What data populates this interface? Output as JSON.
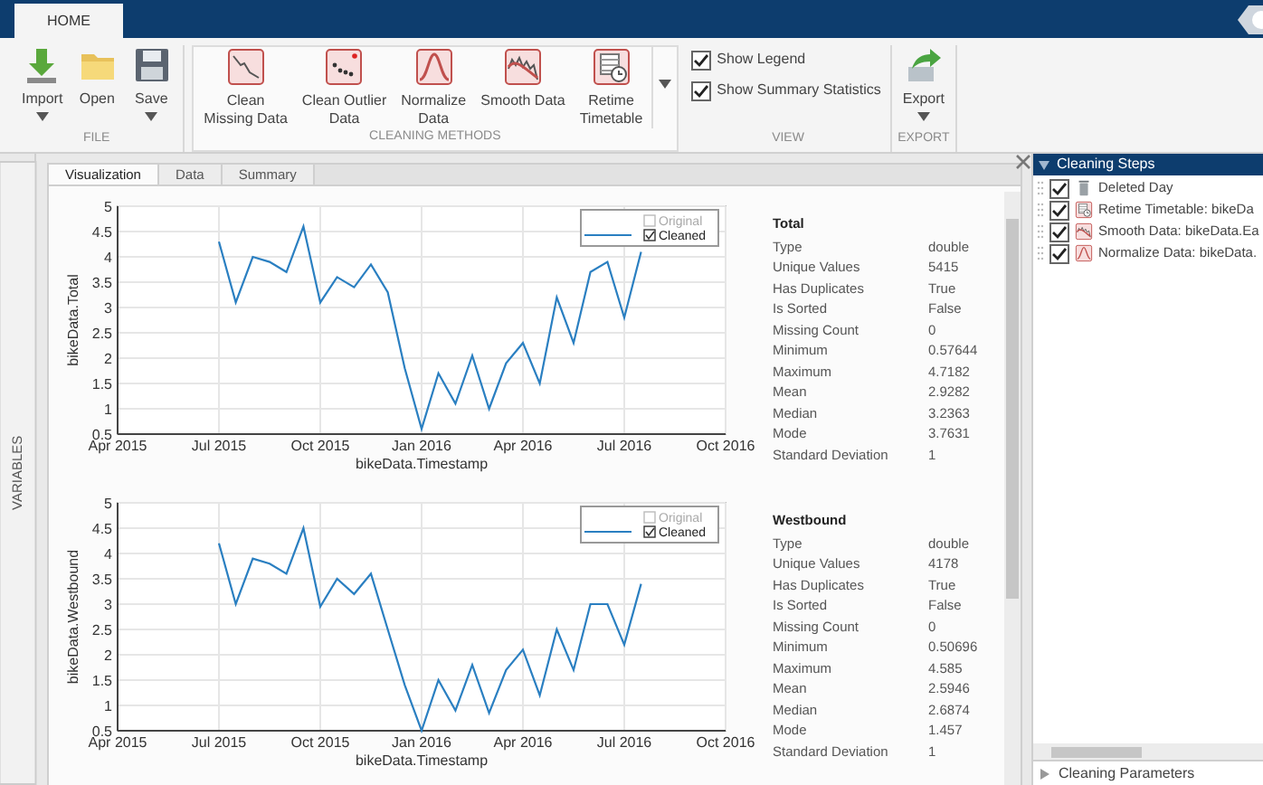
{
  "ribbon": {
    "tabs": [
      {
        "label": "HOME",
        "selected": true
      }
    ],
    "groups": [
      {
        "title": "FILE",
        "buttons": [
          {
            "label": "Import",
            "kind": "import",
            "menu": true
          },
          {
            "label": "Open",
            "kind": "open",
            "menu": false
          },
          {
            "label": "Save",
            "kind": "save",
            "menu": true
          }
        ]
      },
      {
        "title": "CLEANING METHODS",
        "buttons": [
          {
            "label": "Clean\nMissing Data",
            "kind": "missing",
            "menu": false
          },
          {
            "label": "Clean Outlier\nData",
            "kind": "outlier",
            "menu": false
          },
          {
            "label": "Normalize\nData",
            "kind": "normalize",
            "menu": false
          },
          {
            "label": "Smooth Data",
            "kind": "smooth",
            "menu": false
          },
          {
            "label": "Retime\nTimetable",
            "kind": "retime",
            "menu": false
          }
        ]
      },
      {
        "title": "VIEW",
        "checkboxes": [
          {
            "label": "Show Legend",
            "checked": true
          },
          {
            "label": "Show Summary Statistics",
            "checked": true
          }
        ]
      },
      {
        "title": "EXPORT",
        "buttons": [
          {
            "label": "Export",
            "kind": "export",
            "menu": true
          }
        ]
      }
    ]
  },
  "side_tab": "VARIABLES",
  "doc_tabs": [
    {
      "label": "Visualization",
      "selected": true
    },
    {
      "label": "Data",
      "selected": false
    },
    {
      "label": "Summary",
      "selected": false
    }
  ],
  "plots": [
    {
      "chart_data": {
        "type": "line",
        "grid": true,
        "xlabel": "bikeData.Timestamp",
        "ylabel": "bikeData.Total",
        "ylim": [
          0.5,
          5
        ],
        "categories": [
          "Apr 2015",
          null,
          null,
          null,
          null,
          null,
          "Jul 2015",
          null,
          null,
          null,
          null,
          null,
          "Oct 2015",
          null,
          null,
          null,
          null,
          null,
          "Jan 2016",
          null,
          null,
          null,
          null,
          null,
          "Apr 2016",
          null,
          null,
          null,
          null,
          null,
          "Jul 2016",
          null,
          null,
          null,
          null,
          null,
          "Oct 2016"
        ],
        "yticks": [
          {
            "value": 0.5,
            "label": "0.5"
          },
          {
            "value": 1,
            "label": "1"
          },
          {
            "value": 1.5,
            "label": "1.5"
          },
          {
            "value": 2,
            "label": "2"
          },
          {
            "value": 2.5,
            "label": "2.5"
          },
          {
            "value": 3,
            "label": "3"
          },
          {
            "value": 3.5,
            "label": "3.5"
          },
          {
            "value": 4,
            "label": "4"
          },
          {
            "value": 4.5,
            "label": "4.5"
          },
          {
            "value": 5,
            "label": "5"
          }
        ],
        "series": [
          {
            "color": "#2a7fc1",
            "values": [
              null,
              null,
              null,
              null,
              null,
              null,
              4.3,
              3.1,
              4.0,
              3.9,
              3.7,
              4.6,
              3.1,
              3.6,
              3.4,
              3.85,
              3.3,
              1.8,
              0.6,
              1.7,
              1.1,
              2.05,
              1.0,
              1.9,
              2.3,
              1.5,
              3.2,
              2.3,
              3.7,
              3.9,
              2.8,
              4.1,
              null,
              null,
              null,
              null,
              null
            ]
          }
        ]
      },
      "legend": [
        {
          "label": "Original",
          "checked": false
        },
        {
          "label": "Cleaned",
          "checked": true
        }
      ],
      "stats": {
        "title": "Total",
        "rows": [
          {
            "label": "Type",
            "value": "double"
          },
          {
            "label": "Unique Values",
            "value": "5415"
          },
          {
            "label": "Has Duplicates",
            "value": "True"
          },
          {
            "label": "Is Sorted",
            "value": "False"
          },
          {
            "label": "Missing Count",
            "value": "0"
          },
          {
            "label": "Minimum",
            "value": "0.57644"
          },
          {
            "label": "Maximum",
            "value": "4.7182"
          },
          {
            "label": "Mean",
            "value": "2.9282"
          },
          {
            "label": "Median",
            "value": "3.2363"
          },
          {
            "label": "Mode",
            "value": "3.7631"
          },
          {
            "label": "Standard Deviation",
            "value": "1"
          }
        ]
      }
    },
    {
      "chart_data": {
        "type": "line",
        "grid": true,
        "xlabel": "bikeData.Timestamp",
        "ylabel": "bikeData.Westbound",
        "ylim": [
          0.5,
          5
        ],
        "categories": [
          "Apr 2015",
          null,
          null,
          null,
          null,
          null,
          "Jul 2015",
          null,
          null,
          null,
          null,
          null,
          "Oct 2015",
          null,
          null,
          null,
          null,
          null,
          "Jan 2016",
          null,
          null,
          null,
          null,
          null,
          "Apr 2016",
          null,
          null,
          null,
          null,
          null,
          "Jul 2016",
          null,
          null,
          null,
          null,
          null,
          "Oct 2016"
        ],
        "yticks": [
          {
            "value": 0.5,
            "label": "0.5"
          },
          {
            "value": 1,
            "label": "1"
          },
          {
            "value": 1.5,
            "label": "1.5"
          },
          {
            "value": 2,
            "label": "2"
          },
          {
            "value": 2.5,
            "label": "2.5"
          },
          {
            "value": 3,
            "label": "3"
          },
          {
            "value": 3.5,
            "label": "3.5"
          },
          {
            "value": 4,
            "label": "4"
          },
          {
            "value": 4.5,
            "label": "4.5"
          },
          {
            "value": 5,
            "label": "5"
          }
        ],
        "series": [
          {
            "color": "#2a7fc1",
            "values": [
              null,
              null,
              null,
              null,
              null,
              null,
              4.2,
              3.0,
              3.9,
              3.8,
              3.6,
              4.5,
              2.95,
              3.5,
              3.2,
              3.6,
              2.5,
              1.4,
              0.5,
              1.5,
              0.9,
              1.8,
              0.85,
              1.7,
              2.1,
              1.2,
              2.5,
              1.7,
              3.0,
              3.0,
              2.2,
              3.4,
              null,
              null,
              null,
              null,
              null
            ]
          }
        ]
      },
      "legend": [
        {
          "label": "Original",
          "checked": false
        },
        {
          "label": "Cleaned",
          "checked": true
        }
      ],
      "stats": {
        "title": "Westbound",
        "rows": [
          {
            "label": "Type",
            "value": "double"
          },
          {
            "label": "Unique Values",
            "value": "4178"
          },
          {
            "label": "Has Duplicates",
            "value": "True"
          },
          {
            "label": "Is Sorted",
            "value": "False"
          },
          {
            "label": "Missing Count",
            "value": "0"
          },
          {
            "label": "Minimum",
            "value": "0.50696"
          },
          {
            "label": "Maximum",
            "value": "4.585"
          },
          {
            "label": "Mean",
            "value": "2.5946"
          },
          {
            "label": "Median",
            "value": "2.6874"
          },
          {
            "label": "Mode",
            "value": "1.457"
          },
          {
            "label": "Standard Deviation",
            "value": "1"
          }
        ]
      }
    }
  ],
  "steps_panel": {
    "title": "Cleaning Steps",
    "expanded": true,
    "steps": [
      {
        "label": "Deleted Day",
        "kind": "trash",
        "checked": true
      },
      {
        "label": "Retime Timetable: bikeDa",
        "kind": "retime",
        "checked": true
      },
      {
        "label": "Smooth Data: bikeData.Ea",
        "kind": "smooth",
        "checked": true
      },
      {
        "label": "Normalize Data: bikeData.",
        "kind": "normalize",
        "checked": true
      }
    ]
  },
  "params_panel": {
    "title": "Cleaning Parameters",
    "expanded": false
  }
}
